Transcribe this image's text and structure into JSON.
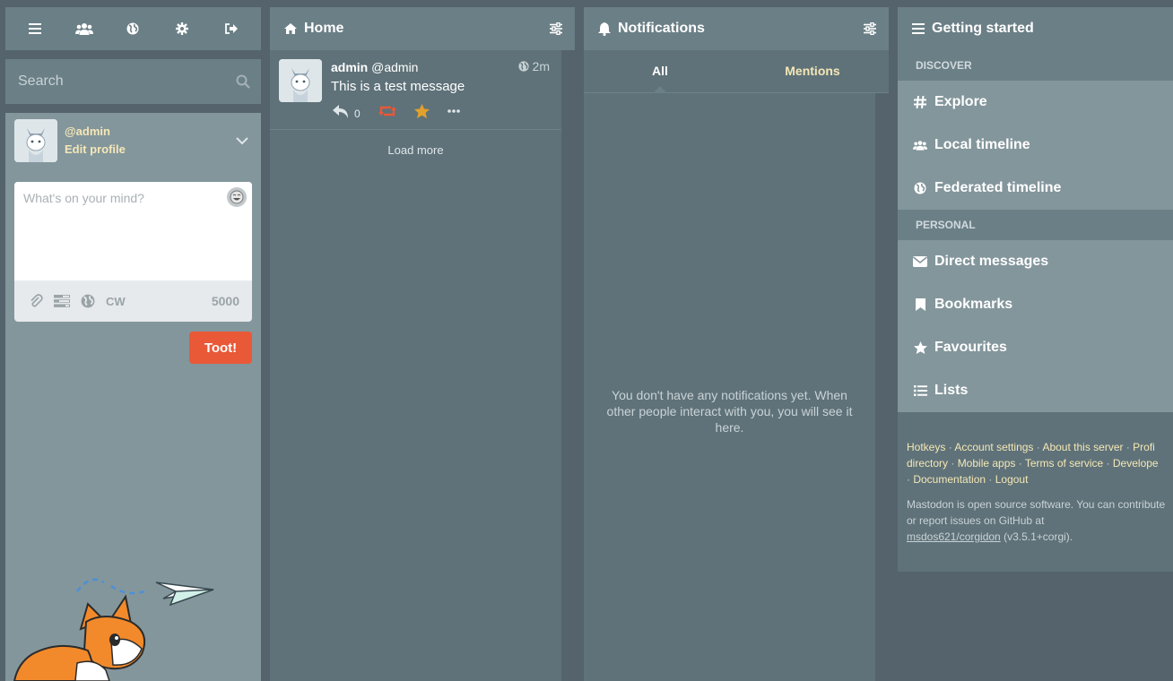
{
  "compose_tabs": {
    "icons": [
      "hamburger-icon",
      "users-icon",
      "globe-icon",
      "gear-icon",
      "sign-out-icon"
    ]
  },
  "search": {
    "placeholder": "Search"
  },
  "account": {
    "handle": "@admin",
    "edit_label": "Edit profile"
  },
  "compose": {
    "placeholder": "What's on your mind?",
    "cw_label": "CW",
    "char_count": "5000",
    "submit_label": "Toot!"
  },
  "home": {
    "title": "Home",
    "status": {
      "display_name": "admin",
      "acct": "@admin",
      "time": "2m",
      "content": "This is a test message",
      "reply_count": "0"
    },
    "load_more": "Load more"
  },
  "notifications": {
    "title": "Notifications",
    "filter_all": "All",
    "filter_mentions": "Mentions",
    "empty": "You don't have any notifications yet. When other people interact with you, you will see it here."
  },
  "getting_started": {
    "title": "Getting started",
    "discover_label": "DISCOVER",
    "explore": "Explore",
    "local": "Local timeline",
    "federated": "Federated timeline",
    "personal_label": "PERSONAL",
    "direct": "Direct messages",
    "bookmarks": "Bookmarks",
    "favourites": "Favourites",
    "lists": "Lists",
    "footer_links": {
      "hotkeys": "Hotkeys",
      "account_settings": "Account settings",
      "about": "About this server",
      "profile_directory_a": "Profi",
      "profile_directory_b": "directory",
      "mobile_apps": "Mobile apps",
      "terms": "Terms of service",
      "developers": "Develope",
      "documentation": "Documentation",
      "logout": "Logout",
      "separator": " · "
    },
    "about_text_1": "Mastodon is open source software. You can contribute or report issues on GitHub at",
    "repo_link": "msdos621/corgidon",
    "version": "(v3.5.1+corgi)."
  },
  "colors": {
    "accent": "#e95837",
    "highlight": "#f4e7b6",
    "favourite": "#e2a12c",
    "boost_active": "#e95837"
  }
}
